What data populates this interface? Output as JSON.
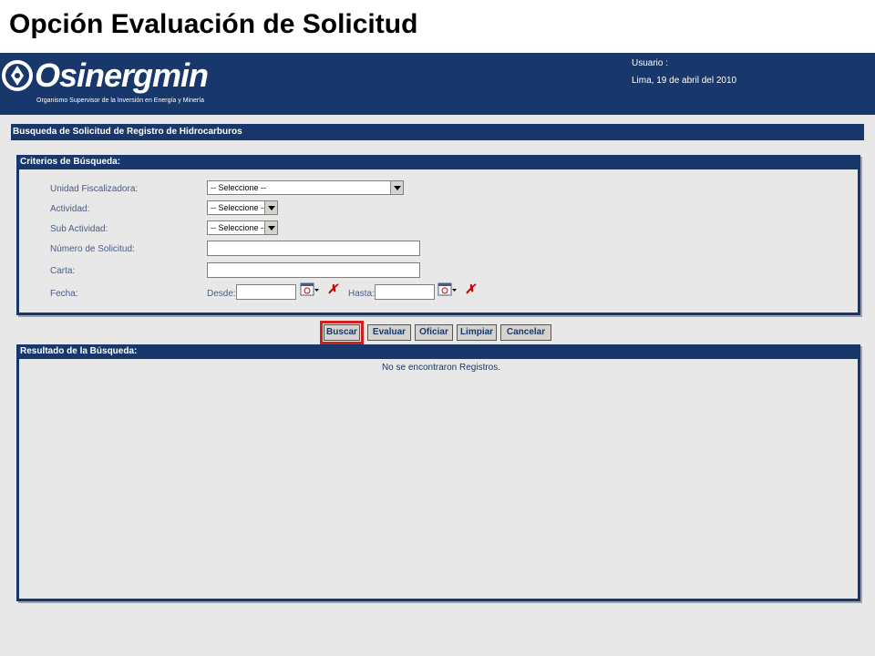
{
  "slide": {
    "title": "Opción Evaluación de Solicitud"
  },
  "header": {
    "logo_text": "Osinergmin",
    "logo_subtitle": "Organismo Supervisor de la Inversión en Energía y Minería",
    "user_label": "Usuario :",
    "date_label": "Lima, 19 de abril del 2010"
  },
  "section": {
    "title": "Busqueda de Solicitud de Registro de Hidrocarburos"
  },
  "criteria": {
    "title": "Criterios de Búsqueda:",
    "fields": {
      "unidad_label": "Unidad Fiscalizadora:",
      "unidad_value": "-- Seleccione --",
      "actividad_label": "Actividad:",
      "actividad_value": "-- Seleccione --",
      "subactividad_label": "Sub Actividad:",
      "subactividad_value": "-- Seleccione --",
      "numero_label": "Número de Solicitud:",
      "numero_value": "",
      "carta_label": "Carta:",
      "carta_value": "",
      "fecha_label": "Fecha:",
      "desde_label": "Desde:",
      "hasta_label": "Hasta:"
    },
    "icons": {
      "calendar": "calendar-icon",
      "clear": "clear-x-icon"
    }
  },
  "buttons": {
    "buscar": "Buscar",
    "evaluar": "Evaluar",
    "oficiar": "Oficiar",
    "limpiar": "Limpiar",
    "cancelar": "Cancelar"
  },
  "results": {
    "title": "Resultado de la Búsqueda:",
    "empty_message": "No se encontraron Registros."
  },
  "colors": {
    "brand": "#18386b",
    "highlight": "#d41e1e",
    "background": "#e8e8e8"
  }
}
